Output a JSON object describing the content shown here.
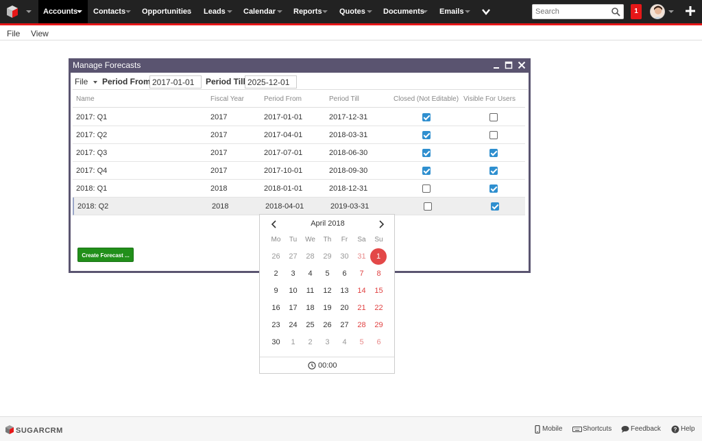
{
  "nav": {
    "items": [
      "Accounts",
      "Contacts",
      "Opportunities",
      "Leads",
      "Calendar",
      "Reports",
      "Quotes",
      "Documents",
      "Emails"
    ],
    "active": "Accounts",
    "search_placeholder": "Search",
    "notification_count": "1"
  },
  "menubar": {
    "file": "File",
    "view": "View"
  },
  "dialog": {
    "title": "Manage Forecasts",
    "toolbar": {
      "file": "File",
      "period_from_label": "Period From",
      "period_from_value": "2017-01-01",
      "period_till_label": "Period Till",
      "period_till_value": "2025-12-01"
    },
    "columns": [
      "Name",
      "Fiscal Year",
      "Period From",
      "Period Till",
      "Closed (Not Editable)",
      "Visible For Users"
    ],
    "rows": [
      {
        "name": "2017: Q1",
        "year": "2017",
        "from": "2017-01-01",
        "till": "2017-12-31",
        "closed": true,
        "visible": false
      },
      {
        "name": "2017: Q2",
        "year": "2017",
        "from": "2017-04-01",
        "till": "2018-03-31",
        "closed": true,
        "visible": false
      },
      {
        "name": "2017: Q3",
        "year": "2017",
        "from": "2017-07-01",
        "till": "2018-06-30",
        "closed": true,
        "visible": true
      },
      {
        "name": "2017: Q4",
        "year": "2017",
        "from": "2017-10-01",
        "till": "2018-09-30",
        "closed": true,
        "visible": true
      },
      {
        "name": "2018: Q1",
        "year": "2018",
        "from": "2018-01-01",
        "till": "2018-12-31",
        "closed": false,
        "visible": true
      },
      {
        "name": "2018: Q2",
        "year": "2018",
        "from": "2018-04-01",
        "till": "2019-03-31",
        "closed": false,
        "visible": true
      }
    ],
    "create_button": "Create Forecast ..."
  },
  "calendar": {
    "month": "April 2018",
    "weekdays": [
      "Mo",
      "Tu",
      "We",
      "Th",
      "Fr",
      "Sa",
      "Su"
    ],
    "weeks": [
      [
        "26",
        "27",
        "28",
        "29",
        "30",
        "31",
        "1"
      ],
      [
        "2",
        "3",
        "4",
        "5",
        "6",
        "7",
        "8"
      ],
      [
        "9",
        "10",
        "11",
        "12",
        "13",
        "14",
        "15"
      ],
      [
        "16",
        "17",
        "18",
        "19",
        "20",
        "21",
        "22"
      ],
      [
        "23",
        "24",
        "25",
        "26",
        "27",
        "28",
        "29"
      ],
      [
        "30",
        "1",
        "2",
        "3",
        "4",
        "5",
        "6"
      ]
    ],
    "time": "00:00"
  },
  "footer": {
    "logo": "SUGARCRM",
    "links": [
      "Mobile",
      "Shortcuts",
      "Feedback",
      "Help"
    ]
  },
  "colors": {
    "nav_bg": "#222222",
    "accent_red": "#e61718",
    "dialog_frame": "#5a5470",
    "checkbox_blue": "#2f8fcf",
    "create_green": "#218f1a",
    "today_red": "#e34848"
  }
}
